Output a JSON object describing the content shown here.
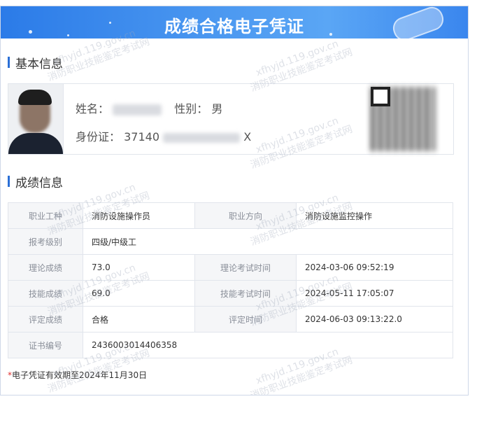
{
  "banner": {
    "title": "成绩合格电子凭证"
  },
  "basic": {
    "heading": "基本信息",
    "name_label": "姓名：",
    "gender_label": "性别：",
    "gender_value": "男",
    "id_label": "身份证：",
    "id_prefix": "37140",
    "id_suffix": "X"
  },
  "grades": {
    "heading": "成绩信息",
    "rows": [
      {
        "l1": "职业工种",
        "v1": "消防设施操作员",
        "l2": "职业方向",
        "v2": "消防设施监控操作"
      },
      {
        "l1": "报考级别",
        "v1": "四级/中级工"
      },
      {
        "l1": "理论成绩",
        "v1": "73.0",
        "l2": "理论考试时间",
        "v2": "2024-03-06 09:52:19"
      },
      {
        "l1": "技能成绩",
        "v1": "69.0",
        "l2": "技能考试时间",
        "v2": "2024-05-11 17:05:07"
      },
      {
        "l1": "评定成绩",
        "v1": "合格",
        "l2": "评定时间",
        "v2": "2024-06-03 09:13:22.0"
      },
      {
        "l1": "证书编号",
        "v1": "2436003014406358"
      }
    ]
  },
  "note": {
    "star": "*",
    "text": "电子凭证有效期至2024年11月30日"
  },
  "watermark": {
    "line1": "xfhyjd.119.gov.cn",
    "line2": "消防职业技能鉴定考试网"
  },
  "colors": {
    "banner": "#3a8aee",
    "section_bar": "#2b6fd6",
    "skill_score": "#2a84d2",
    "pass": "#3aa146",
    "note_star": "#e0312f"
  }
}
